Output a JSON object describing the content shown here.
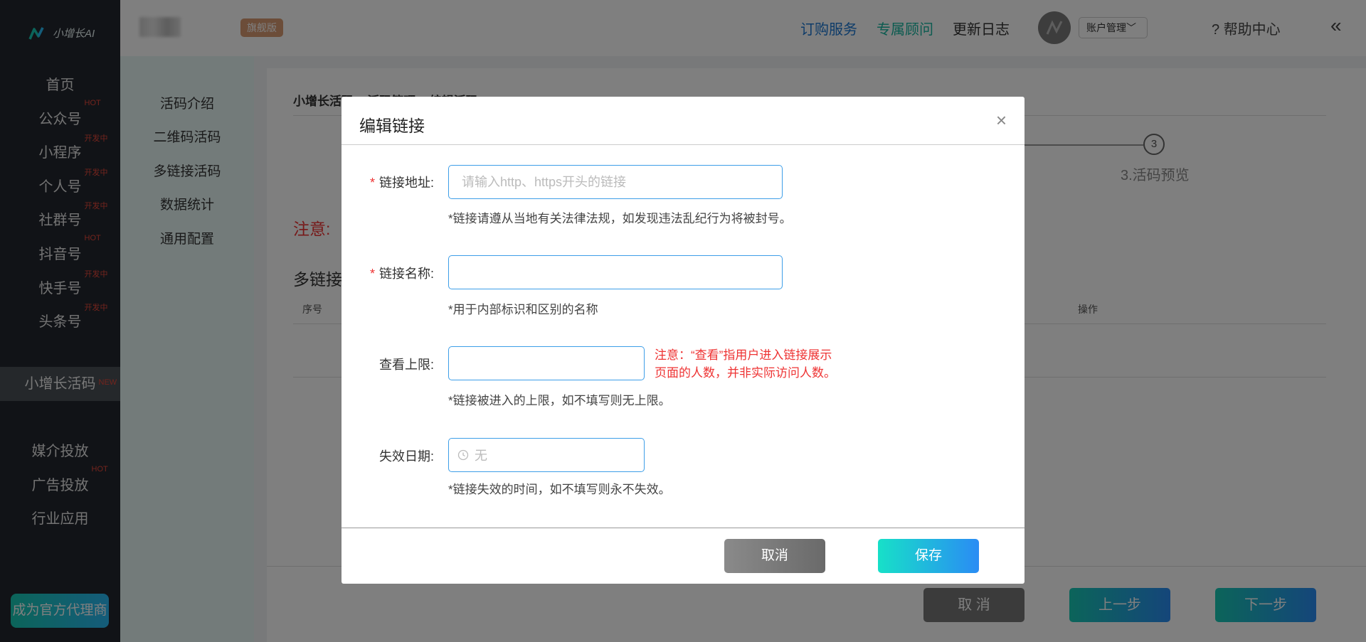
{
  "brand": {
    "name": "小增长AI"
  },
  "topbar": {
    "edition_badge": "旗舰版",
    "links": [
      "订购服务",
      "专属顾问",
      "更新日志"
    ],
    "link_colors": [
      "#1a77d2",
      "#17b6a0",
      "#333333"
    ],
    "account_label": "账户管理",
    "help_label": "帮助中心",
    "collapse_icon": "double-chevron-left-icon"
  },
  "sidebar": {
    "items": [
      {
        "label": "首页",
        "badge": ""
      },
      {
        "label": "公众号",
        "badge": "HOT"
      },
      {
        "label": "小程序",
        "badge": "开发中"
      },
      {
        "label": "个人号",
        "badge": "开发中"
      },
      {
        "label": "社群号",
        "badge": "开发中"
      },
      {
        "label": "抖音号",
        "badge": "HOT"
      },
      {
        "label": "快手号",
        "badge": "开发中"
      },
      {
        "label": "头条号",
        "badge": "开发中"
      },
      {
        "label": "小增长活码",
        "badge": "NEW"
      },
      {
        "label": "媒介投放",
        "badge": ""
      },
      {
        "label": "广告投放",
        "badge": "HOT"
      },
      {
        "label": "行业应用",
        "badge": ""
      }
    ],
    "agent_button": "成为官方代理商"
  },
  "subnav": {
    "items": [
      "活码介绍",
      "二维码活码",
      "多链接活码",
      "数据统计",
      "通用配置"
    ]
  },
  "background": {
    "breadcrumb": "小增长活码 > 活码管理 > 编辑活码",
    "step3_number": "3",
    "step3_label": "3.活码预览",
    "note": "注意:",
    "section_title": "多链接",
    "table_headers": {
      "index": "序号",
      "ops": "操作"
    },
    "footer_buttons": {
      "cancel": "取 消",
      "prev": "上一步",
      "next": "下一步"
    }
  },
  "modal": {
    "title": "编辑链接",
    "close_icon": "close-icon",
    "fields": {
      "url": {
        "label": "链接地址:",
        "required": true,
        "value": "",
        "placeholder": "请输入http、https开头的链接",
        "hint": "*链接请遵从当地有关法律法规，如发现违法乱纪行为将被封号。"
      },
      "name": {
        "label": "链接名称:",
        "required": true,
        "value": "",
        "placeholder": "",
        "hint": "*用于内部标识和区别的名称"
      },
      "limit": {
        "label": "查看上限:",
        "required": false,
        "value": "",
        "placeholder": "",
        "warning": "注意：“查看”指用户进入链接展示页面的人数，并非实际访问人数。",
        "hint": "*链接被进入的上限，如不填写则无上限。"
      },
      "expiry": {
        "label": "失效日期:",
        "required": false,
        "value": "无",
        "icon": "clock-icon",
        "hint": "*链接失效的时间，如不填写则永不失效。"
      }
    },
    "buttons": {
      "cancel": "取消",
      "save": "保存"
    }
  },
  "colors": {
    "accent_teal": "#17c9b4",
    "accent_blue": "#2a8cf4",
    "input_border": "#3d9ee8",
    "warning_red": "#e33333"
  }
}
